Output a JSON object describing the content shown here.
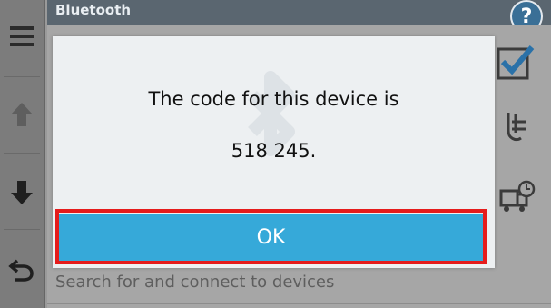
{
  "header": {
    "title": "Bluetooth",
    "help_label": "?"
  },
  "nav": {
    "items": [
      "menu-icon",
      "arrow-up-icon",
      "arrow-down-icon",
      "back-icon"
    ]
  },
  "dialog": {
    "message_line1": "The code for this device is",
    "message_line2": "518 245.",
    "ok_label": "OK"
  },
  "background": {
    "search_text": "Search for and connect to devices"
  },
  "colors": {
    "accent": "#36a9d9",
    "highlight": "#e51c1c",
    "titlebar": "#5a6670"
  }
}
